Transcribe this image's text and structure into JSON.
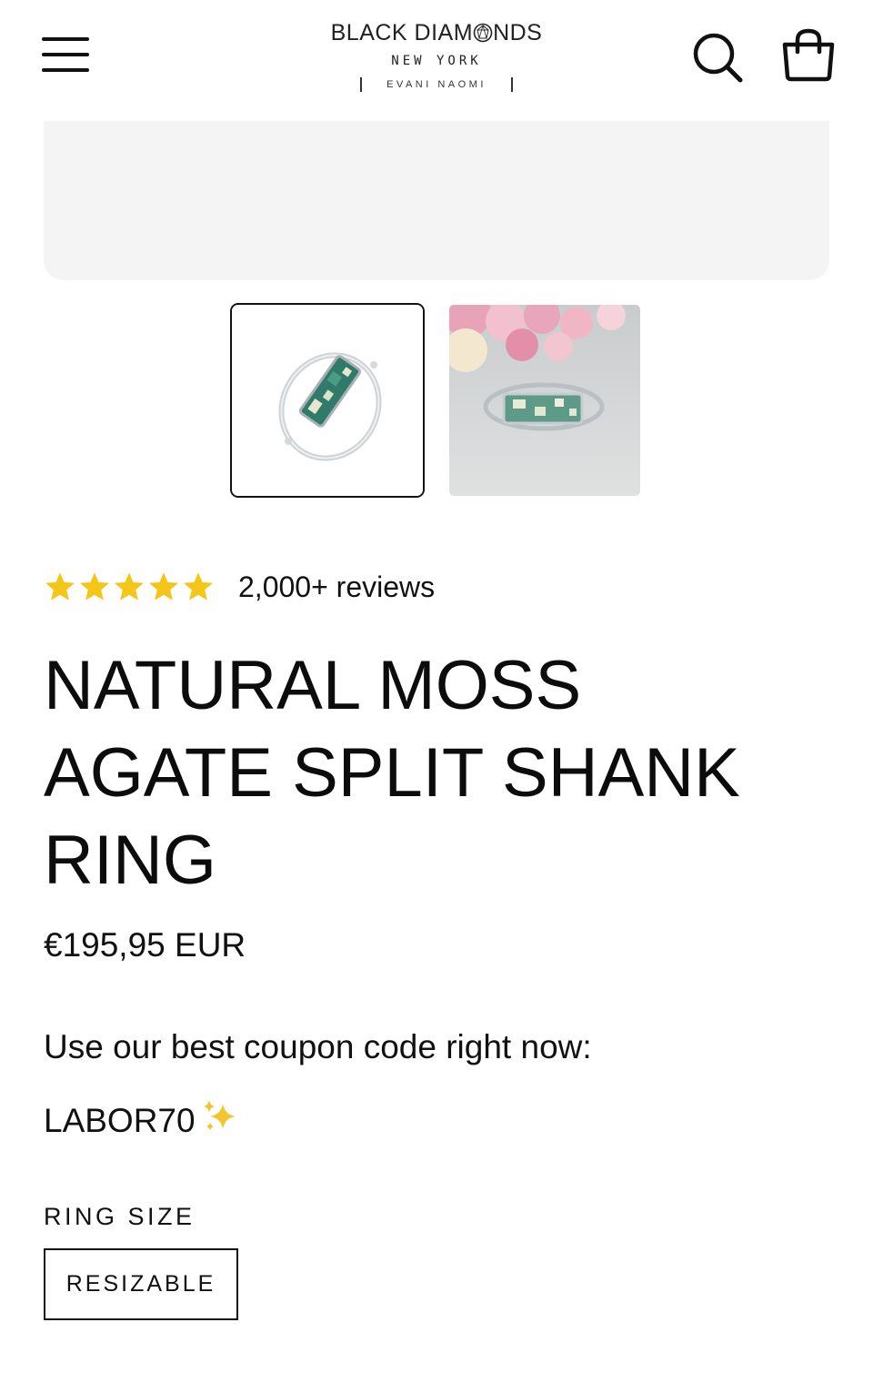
{
  "header": {
    "logo_main": "BLACK DIAM",
    "logo_main_end": "NDS",
    "logo_sub": "NEW YORK",
    "logo_sub2": "EVANI NAOMI",
    "menu_icon": "hamburger-menu-icon",
    "search_icon": "search-icon",
    "bag_icon": "shopping-bag-icon"
  },
  "gallery": {
    "thumbnails": [
      {
        "name": "ring-product-thumbnail",
        "selected": true
      },
      {
        "name": "ring-lifestyle-thumbnail",
        "selected": false
      }
    ]
  },
  "product": {
    "rating": 5,
    "reviews": "2,000+ reviews",
    "title": "NATURAL MOSS AGATE SPLIT SHANK RING",
    "price": "€195,95 EUR",
    "coupon_text": "Use our best coupon code right now:",
    "coupon_code": "LABOR70",
    "coupon_emoji": "✨",
    "size_label": "RING SIZE",
    "size_option": "RESIZABLE"
  },
  "colors": {
    "star": "#F5C518",
    "text": "#111111",
    "image_bg": "#F4F4F4"
  }
}
